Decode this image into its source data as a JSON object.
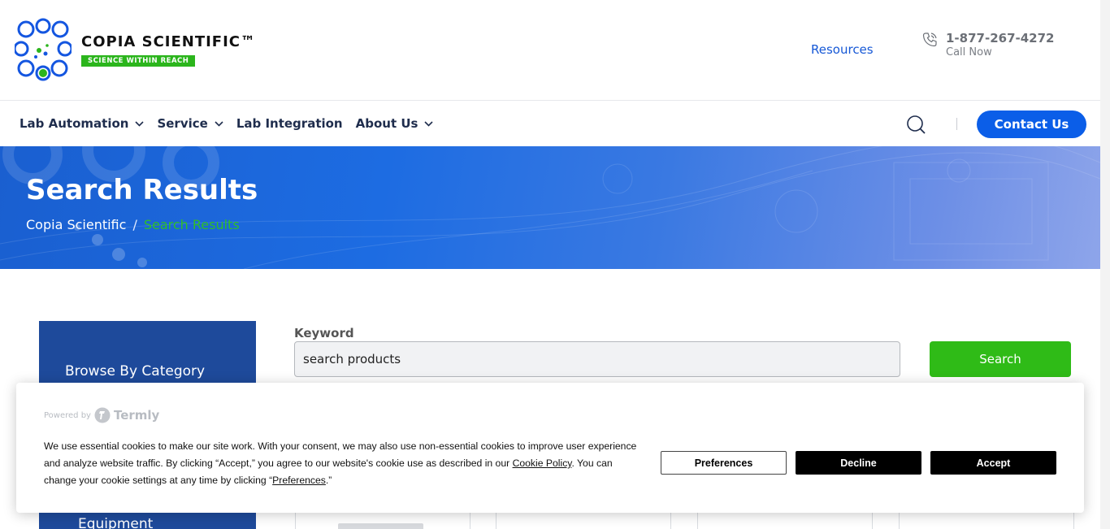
{
  "header": {
    "logo": {
      "name": "COPIA SCIENTIFIC™",
      "tagline": "SCIENCE WITHIN REACH"
    },
    "resources_label": "Resources",
    "phone": {
      "number": "1-877-267-4272",
      "caption": "Call Now"
    }
  },
  "nav": {
    "items": [
      {
        "label": "Lab Automation",
        "has_dropdown": true
      },
      {
        "label": "Service",
        "has_dropdown": true
      },
      {
        "label": "Lab Integration",
        "has_dropdown": false
      },
      {
        "label": "About Us",
        "has_dropdown": true
      }
    ],
    "contact_label": "Contact Us"
  },
  "hero": {
    "title": "Search Results",
    "breadcrumb": [
      "Copia Scientific",
      "Search Results"
    ],
    "breadcrumb_separator": "/"
  },
  "sidebar": {
    "title": "Browse By Category",
    "partial_item": "Equipment"
  },
  "search": {
    "keyword_label": "Keyword",
    "input_value": "search products",
    "button_label": "Search"
  },
  "cookie_banner": {
    "powered_by": "Powered by",
    "brand": "Termly",
    "text_before_link": "We use essential cookies to make our site work. With your consent, we may also use non-essential cookies to improve user experience and analyze website traffic. By clicking “Accept,” you agree to our website's cookie use as described in our ",
    "cookie_policy_link": "Cookie Policy",
    "text_middle": ". You can change your cookie settings at any time by clicking “",
    "preferences_link": "Preferences",
    "text_end": ".”",
    "buttons": {
      "preferences": "Preferences",
      "decline": "Decline",
      "accept": "Accept"
    }
  },
  "colors": {
    "brand_blue": "#0b5ee8",
    "brand_green": "#2fbb17",
    "navy": "#1e4a9b",
    "text_dark": "#1f2d4d"
  }
}
